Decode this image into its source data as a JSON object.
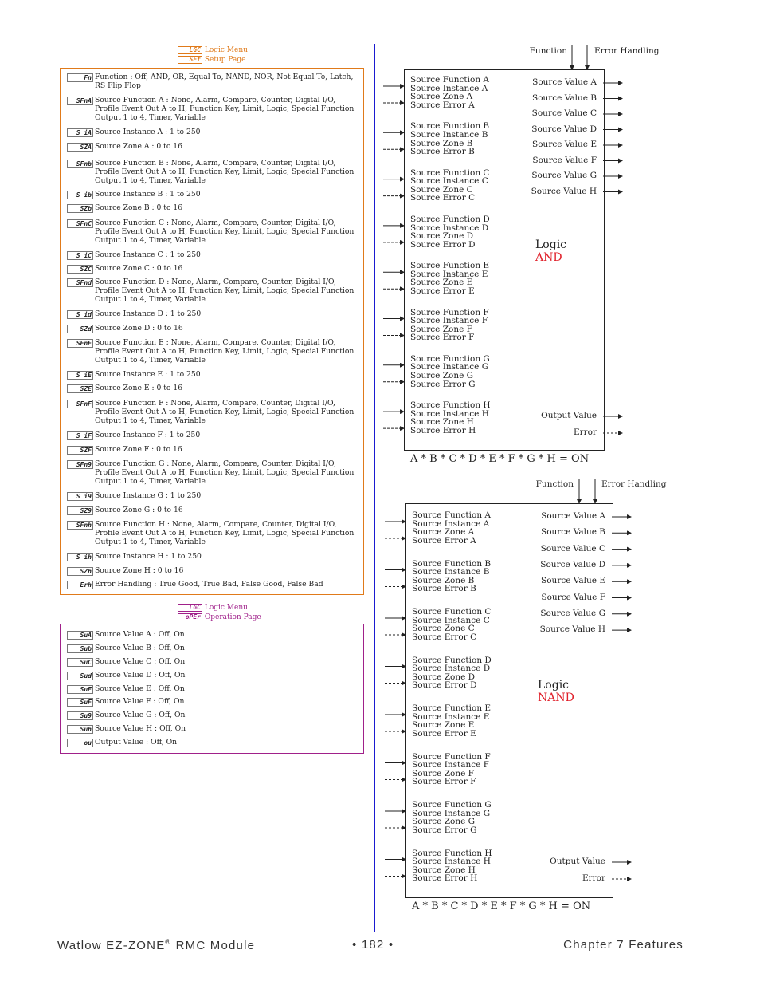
{
  "setup_menu": {
    "menu_code": "LGC",
    "menu_label": "Logic Menu",
    "page_code": "SEt",
    "page_label": "Setup Page",
    "params": [
      {
        "code": "Fn",
        "text": "Function : Off, AND, OR, Equal To, NAND, NOR, Not Equal To, Latch, RS Flip Flop"
      },
      {
        "code": "SFnA",
        "text": "Source Function A : None, Alarm, Compare, Counter, Digital I/O, Profile Event Out A to H, Function Key, Limit, Logic, Special Function Output 1 to 4, Timer, Variable"
      },
      {
        "code": "S iA",
        "text": "Source Instance A : 1 to 250"
      },
      {
        "code": "SZA",
        "text": "Source Zone A : 0 to 16"
      },
      {
        "code": "SFnb",
        "text": "Source Function B : None, Alarm, Compare, Counter, Digital I/O, Profile Event Out A to H, Function Key, Limit, Logic, Special Function Output 1 to 4, Timer, Variable"
      },
      {
        "code": "S ib",
        "text": "Source Instance B : 1 to 250"
      },
      {
        "code": "SZb",
        "text": "Source Zone B : 0 to 16"
      },
      {
        "code": "SFnC",
        "text": "Source Function C : None, Alarm, Compare, Counter, Digital I/O, Profile Event Out A to H, Function Key, Limit, Logic, Special Function Output 1 to 4, Timer, Variable"
      },
      {
        "code": "S iC",
        "text": "Source Instance C : 1 to 250"
      },
      {
        "code": "SZC",
        "text": "Source Zone C : 0 to 16"
      },
      {
        "code": "SFnd",
        "text": "Source Function D : None, Alarm, Compare, Counter, Digital I/O, Profile Event Out A to H, Function Key, Limit, Logic, Special Function Output 1 to 4, Timer, Variable"
      },
      {
        "code": "S id",
        "text": "Source Instance D : 1 to 250"
      },
      {
        "code": "SZd",
        "text": "Source Zone D : 0 to 16"
      },
      {
        "code": "SFnE",
        "text": "Source Function E : None, Alarm, Compare, Counter, Digital I/O, Profile Event Out A to H, Function Key, Limit, Logic, Special Function Output 1 to 4, Timer, Variable"
      },
      {
        "code": "S iE",
        "text": "Source Instance E : 1 to 250"
      },
      {
        "code": "SZE",
        "text": "Source Zone E : 0 to 16"
      },
      {
        "code": "SFnF",
        "text": "Source Function F : None, Alarm, Compare, Counter, Digital I/O, Profile Event Out A to H, Function Key, Limit, Logic, Special Function Output 1 to 4, Timer, Variable"
      },
      {
        "code": "S iF",
        "text": "Source Instance F : 1 to 250"
      },
      {
        "code": "SZF",
        "text": "Source Zone F : 0 to 16"
      },
      {
        "code": "SFn9",
        "text": "Source Function G : None, Alarm, Compare, Counter, Digital I/O, Profile Event Out A to H, Function Key, Limit, Logic, Special Function Output 1 to 4, Timer, Variable"
      },
      {
        "code": "S i9",
        "text": "Source Instance G : 1 to 250"
      },
      {
        "code": "SZ9",
        "text": "Source Zone G : 0 to 16"
      },
      {
        "code": "SFnh",
        "text": "Source Function H : None, Alarm, Compare, Counter, Digital I/O, Profile Event Out A to H, Function Key, Limit, Logic, Special Function Output 1 to 4, Timer, Variable"
      },
      {
        "code": "S ih",
        "text": "Source Instance H : 1 to 250"
      },
      {
        "code": "SZh",
        "text": "Source Zone H : 0 to 16"
      },
      {
        "code": "Erh",
        "text": "Error Handling : True Good, True Bad, False Good, False Bad"
      }
    ]
  },
  "operation_menu": {
    "menu_code": "LGC",
    "menu_label": "Logic Menu",
    "page_code": "oPEr",
    "page_label": "Operation Page",
    "params": [
      {
        "code": "SuA",
        "text": "Source Value A : Off, On"
      },
      {
        "code": "Sub",
        "text": "Source Value B : Off, On"
      },
      {
        "code": "SuC",
        "text": "Source Value C : Off, On"
      },
      {
        "code": "Sud",
        "text": "Source Value D : Off, On"
      },
      {
        "code": "SuE",
        "text": "Source Value E : Off, On"
      },
      {
        "code": "SuF",
        "text": "Source Value F : Off, On"
      },
      {
        "code": "Su9",
        "text": "Source Value G : Off, On"
      },
      {
        "code": "Suh",
        "text": "Source Value H : Off, On"
      },
      {
        "code": "ou",
        "text": "Output Value : Off, On"
      }
    ]
  },
  "diagrams": [
    {
      "function_label": "Function",
      "error_handling_label": "Error Handling",
      "title": "Logic",
      "type": "AND",
      "equation": "A * B * C * D * E * F * G * H = ON",
      "equation_suffix": "",
      "overline": false,
      "inputs": [
        [
          "Source Function A",
          "Source Instance A",
          "Source Zone A",
          "Source Error A"
        ],
        [
          "Source Function B",
          "Source Instance B",
          "Source Zone B",
          "Source Error B"
        ],
        [
          "Source Function C",
          "Source Instance C",
          "Source Zone C",
          "Source Error C"
        ],
        [
          "Source Function D",
          "Source Instance D",
          "Source Zone D",
          "Source Error D"
        ],
        [
          "Source Function E",
          "Source Instance E",
          "Source Zone E",
          "Source Error E"
        ],
        [
          "Source Function F",
          "Source Instance F",
          "Source Zone F",
          "Source Error F"
        ],
        [
          "Source Function G",
          "Source Instance G",
          "Source Zone G",
          "Source Error G"
        ],
        [
          "Source Function H",
          "Source Instance H",
          "Source Zone H",
          "Source Error H"
        ]
      ],
      "outputs": [
        "Source Value A",
        "Source Value B",
        "Source Value C",
        "Source Value D",
        "Source Value E",
        "Source Value F",
        "Source Value G",
        "Source Value H"
      ],
      "output_value_label": "Output Value",
      "error_label": "Error"
    },
    {
      "function_label": "Function",
      "error_handling_label": "Error Handling",
      "title": "Logic",
      "type": "NAND",
      "equation": "A * B * C * D * E * F * G * H",
      "equation_suffix": " = ON",
      "overline": true,
      "inputs": [
        [
          "Source Function A",
          "Source Instance A",
          "Source Zone A",
          "Source Error A"
        ],
        [
          "Source Function B",
          "Source Instance B",
          "Source Zone B",
          "Source Error B"
        ],
        [
          "Source Function C",
          "Source Instance C",
          "Source Zone C",
          "Source Error C"
        ],
        [
          "Source Function D",
          "Source Instance D",
          "Source Zone D",
          "Source Error D"
        ],
        [
          "Source Function E",
          "Source Instance E",
          "Source Zone E",
          "Source Error E"
        ],
        [
          "Source Function F",
          "Source Instance F",
          "Source Zone F",
          "Source Error F"
        ],
        [
          "Source Function G",
          "Source Instance G",
          "Source Zone G",
          "Source Error G"
        ],
        [
          "Source Function H",
          "Source Instance H",
          "Source Zone H",
          "Source Error H"
        ]
      ],
      "outputs": [
        "Source Value A",
        "Source Value B",
        "Source Value C",
        "Source Value D",
        "Source Value E",
        "Source Value F",
        "Source Value G",
        "Source Value H"
      ],
      "output_value_label": "Output Value",
      "error_label": "Error"
    }
  ],
  "footer": {
    "product": "Watlow EZ-ZONE",
    "registered": "®",
    "product_suffix": " RMC Module",
    "page": "•  182  •",
    "chapter": "Chapter 7 Features"
  }
}
